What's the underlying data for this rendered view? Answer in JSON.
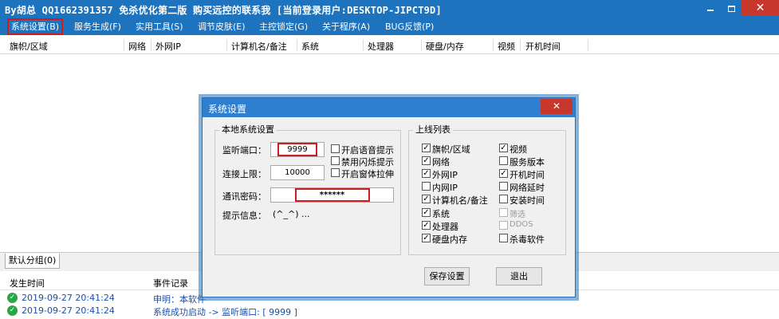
{
  "window": {
    "title": "By胡总 QQ1662391357 免杀优化第二版 购买远控的联系我 [当前登录用户:DESKTOP-JIPCT9D]",
    "minimize": "",
    "maximize": "",
    "close": "✕"
  },
  "menu": [
    {
      "label": "系统设置(B)"
    },
    {
      "label": "服务生成(F)"
    },
    {
      "label": "实用工具(S)"
    },
    {
      "label": "调节皮肤(E)"
    },
    {
      "label": "主控锁定(G)"
    },
    {
      "label": "关于程序(A)"
    },
    {
      "label": "BUG反馈(P)"
    }
  ],
  "list_columns": [
    "旗帜/区域",
    "网络",
    "外网IP",
    "计算机名/备注",
    "系统",
    "处理器",
    "硬盘/内存",
    "视频",
    "开机时间"
  ],
  "group_tab": "默认分组(0)",
  "log": {
    "columns": [
      "发生时间",
      "事件记录"
    ],
    "rows": [
      {
        "time": "2019-09-27 20:41:24",
        "message": "申明：本软件"
      },
      {
        "time": "2019-09-27 20:41:24",
        "message": "系统成功启动 -> 监听端口: [ 9999 ]"
      }
    ]
  },
  "dialog": {
    "title": "系统设置",
    "close": "✕",
    "local_group": {
      "legend": "本地系统设置",
      "port_label": "监听端口：",
      "port_value": "9999",
      "limit_label": "连接上限：",
      "limit_value": "10000",
      "password_label": "通讯密码：",
      "password_value": "******",
      "hint_label": "提示信息：",
      "hint_value": "(^_^) ...",
      "options": [
        {
          "label": "开启语音提示",
          "checked": false
        },
        {
          "label": "禁用闪烁提示",
          "checked": false
        },
        {
          "label": "开启窗体拉伸",
          "checked": false
        }
      ]
    },
    "online_group": {
      "legend": "上线列表",
      "left": [
        {
          "label": "旗帜/区域",
          "checked": true
        },
        {
          "label": "网络",
          "checked": true
        },
        {
          "label": "外网IP",
          "checked": true
        },
        {
          "label": "内网IP",
          "checked": false
        },
        {
          "label": "计算机名/备注",
          "checked": true
        },
        {
          "label": "系统",
          "checked": true
        },
        {
          "label": "处理器",
          "checked": true
        },
        {
          "label": "硬盘内存",
          "checked": true
        }
      ],
      "right": [
        {
          "label": "视频",
          "checked": true,
          "disabled": false
        },
        {
          "label": "服务版本",
          "checked": false,
          "disabled": false
        },
        {
          "label": "开机时间",
          "checked": true,
          "disabled": false
        },
        {
          "label": "网络延时",
          "checked": false,
          "disabled": false
        },
        {
          "label": "安装时间",
          "checked": false,
          "disabled": false
        },
        {
          "label": "筛选",
          "checked": false,
          "disabled": true
        },
        {
          "label": "DDOS",
          "checked": false,
          "disabled": true
        },
        {
          "label": "杀毒软件",
          "checked": false,
          "disabled": false
        }
      ]
    },
    "save_button": "保存设置",
    "exit_button": "退出"
  },
  "colors": {
    "titlebar": "#1e73be",
    "close_red": "#c7372b",
    "highlight_red": "#d21b1b",
    "log_text": "#1b4fa8",
    "ok_green": "#29a745"
  },
  "icons": {
    "log_status": "check-circle-icon",
    "checkbox_mark": "✓"
  }
}
